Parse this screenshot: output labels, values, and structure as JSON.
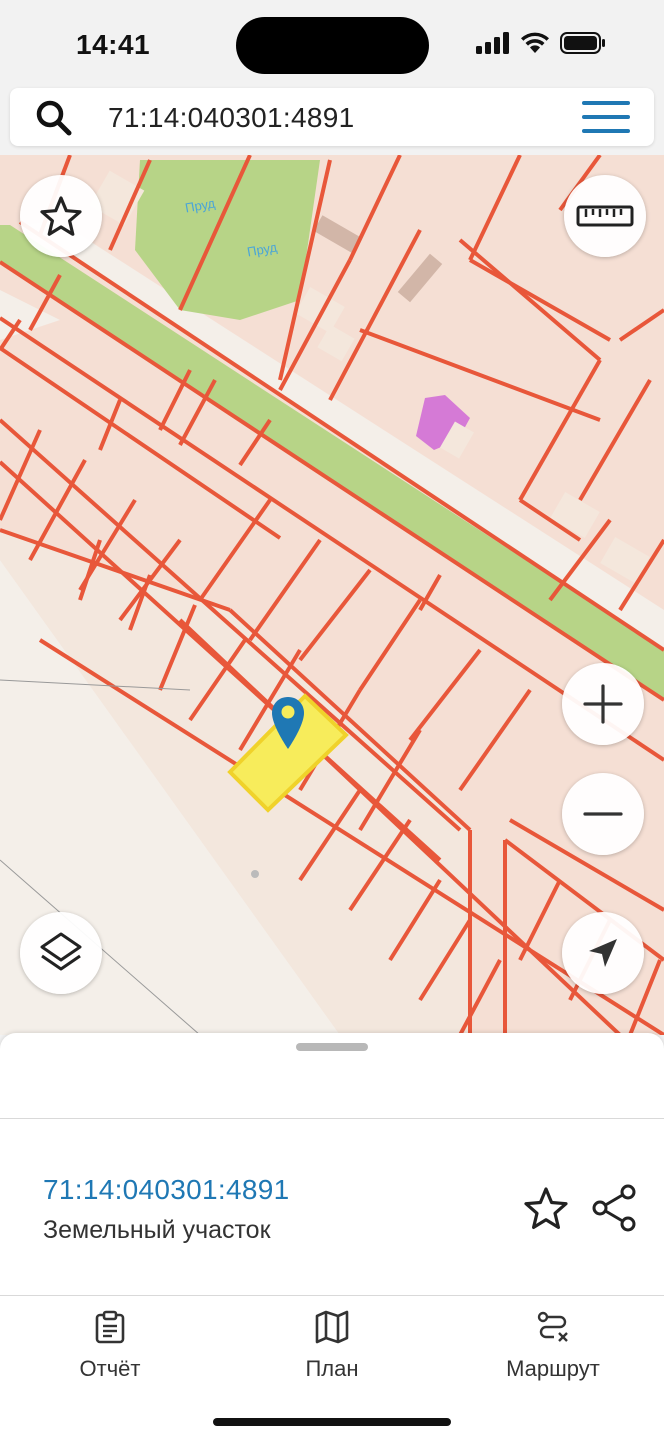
{
  "status_bar": {
    "time": "14:41",
    "icons": [
      "signal-icon",
      "wifi-icon",
      "battery-icon"
    ]
  },
  "search": {
    "value": "71:14:040301:4891",
    "icon": "search-icon",
    "menu_icon": "hamburger-menu-icon"
  },
  "map": {
    "labels": [
      "Пруд",
      "Пруд"
    ],
    "colors": {
      "parcel_border": "#e8573a",
      "parcel_fill": "#f5dfd4",
      "road": "#f4efe9",
      "green": "#b7d487",
      "selected_fill": "#f7ec5b",
      "selected_border": "#f0d22a",
      "building": "#d57ad6",
      "marker": "#1f78b4"
    },
    "controls": {
      "favorite": "star-icon",
      "ruler": "ruler-icon",
      "zoom_in": "plus-icon",
      "zoom_out": "minus-icon",
      "layers": "layers-icon",
      "locate": "navigation-arrow-icon"
    }
  },
  "sheet": {
    "parcel_id": "71:14:040301:4891",
    "parcel_type": "Земельный участок",
    "actions": [
      "star-icon",
      "share-icon"
    ]
  },
  "tabs": [
    {
      "label": "Отчёт",
      "icon": "clipboard-icon"
    },
    {
      "label": "План",
      "icon": "map-icon"
    },
    {
      "label": "Маршрут",
      "icon": "route-icon"
    }
  ]
}
